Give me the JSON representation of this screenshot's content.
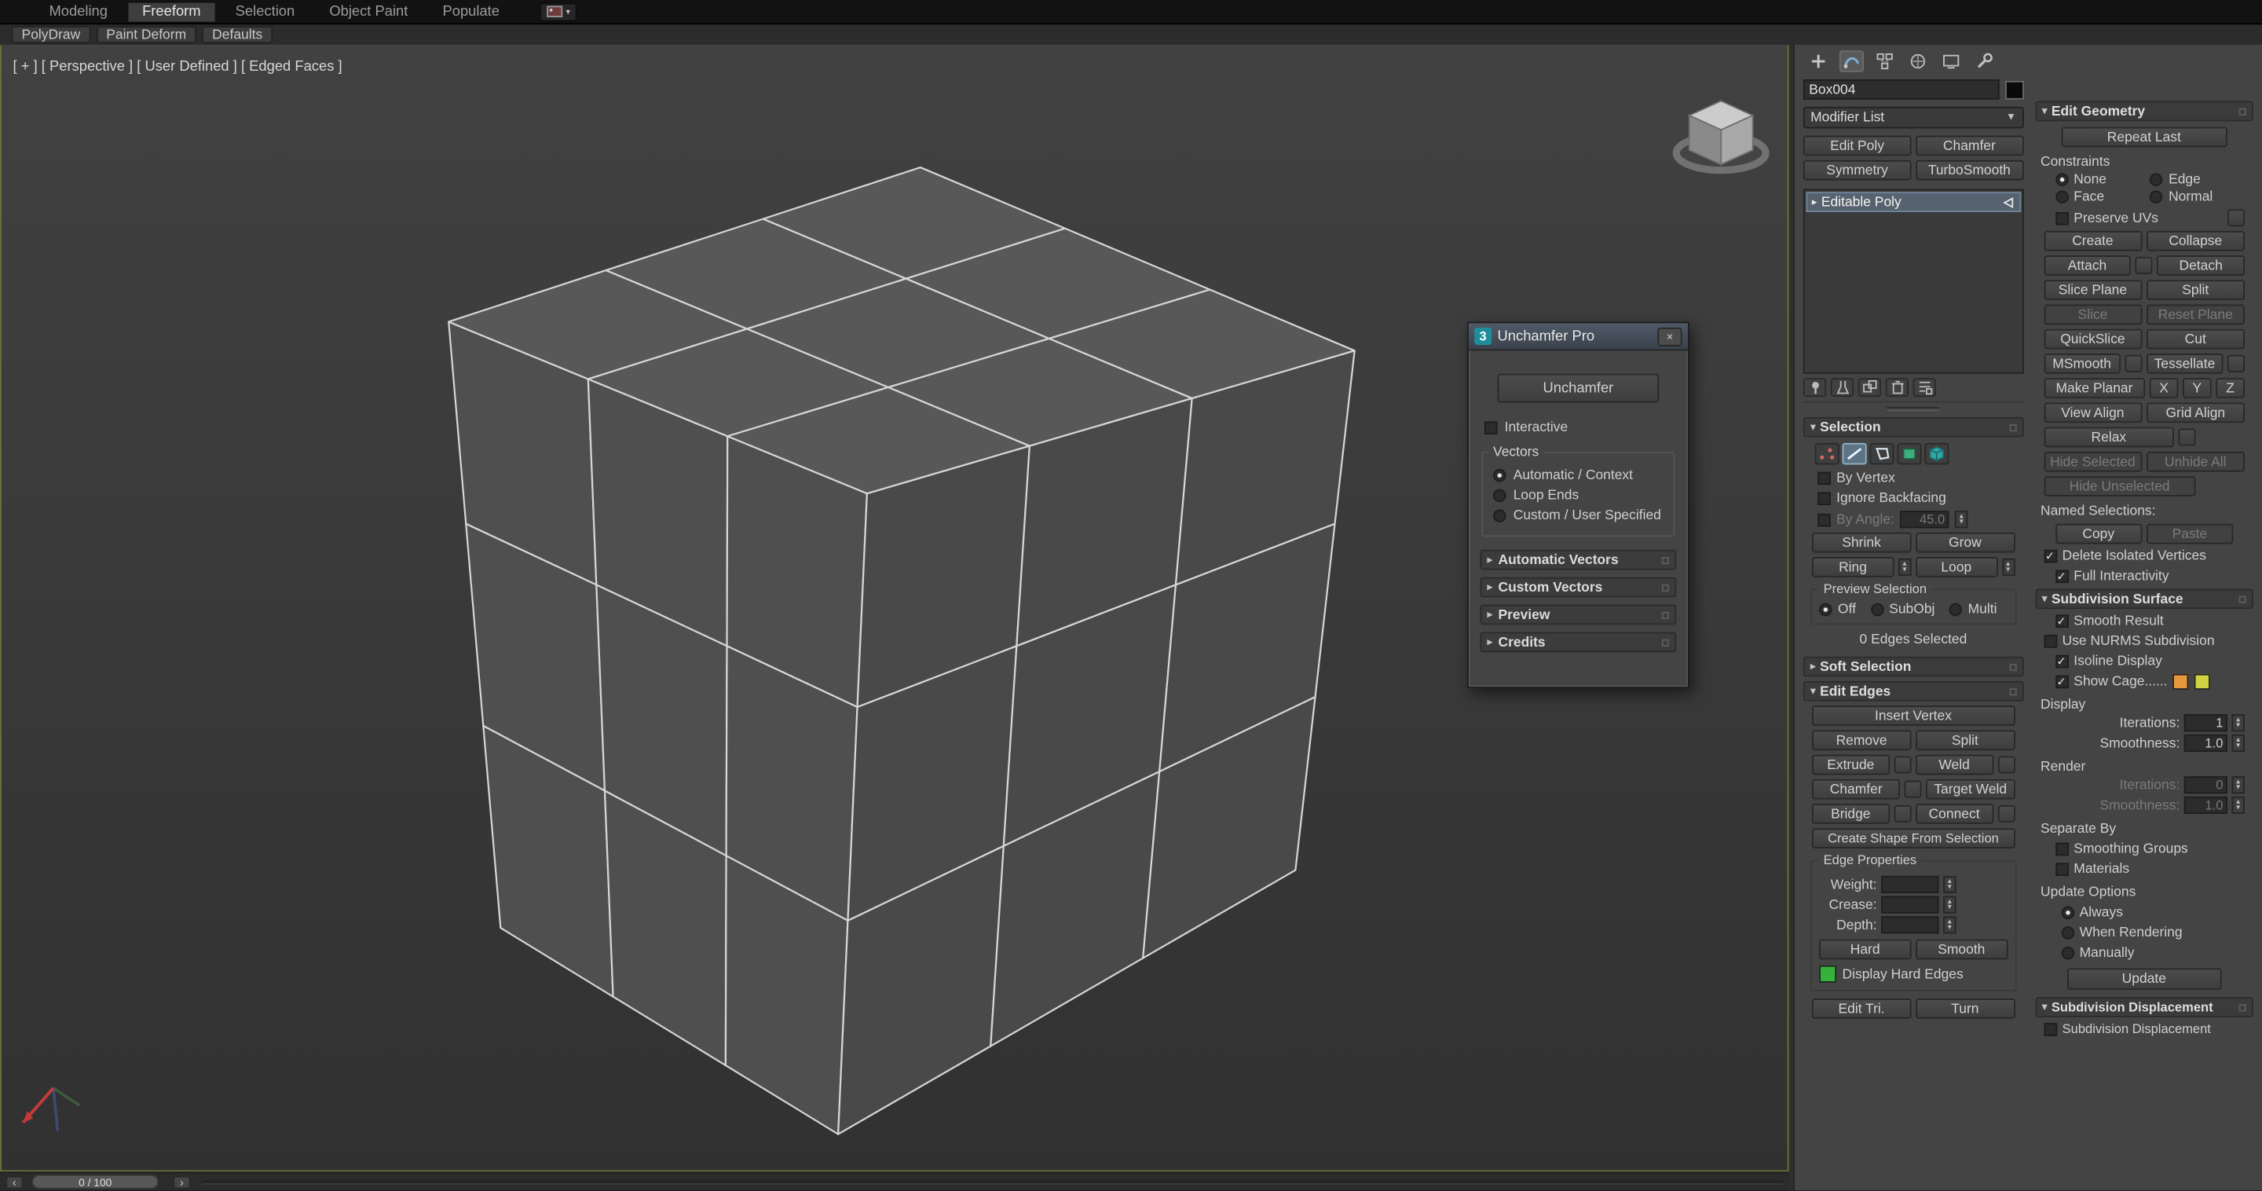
{
  "icons": {
    "close": "×",
    "dropdown": "▼",
    "up": "▴",
    "down": "▾",
    "expanded": "▾",
    "collapsed": "▸",
    "stack_arrow": "▸",
    "left": "‹",
    "right": "›",
    "logo": "3",
    "check": "✓"
  },
  "colors": {
    "viewport_border": "#70703e",
    "selection_highlight": "#566270",
    "object_color_swatch": "#0a0a0a",
    "hard_edges_swatch": "#35b23b",
    "cage_swatch_1": "#e8983c",
    "cage_swatch_2": "#cfd342"
  },
  "ribbon": {
    "tabs": [
      {
        "label": "Modeling"
      },
      {
        "label": "Freeform"
      },
      {
        "label": "Selection"
      },
      {
        "label": "Object Paint"
      },
      {
        "label": "Populate"
      }
    ],
    "active_tab": "Freeform",
    "subtabs": [
      {
        "label": "PolyDraw"
      },
      {
        "label": "Paint Deform"
      },
      {
        "label": "Defaults"
      }
    ]
  },
  "viewport": {
    "label": "[ + ] [ Perspective ] [ User Defined ] [ Edged Faces ]"
  },
  "dialog": {
    "title": "Unchamfer Pro",
    "buttons": {
      "unchamfer": "Unchamfer"
    },
    "interactive": "Interactive",
    "vectors": {
      "label": "Vectors",
      "automatic": "Automatic / Context",
      "loop_ends": "Loop Ends",
      "custom": "Custom / User Specified",
      "selected": "Automatic / Context"
    },
    "rollouts": {
      "automatic_vectors": "Automatic Vectors",
      "custom_vectors": "Custom Vectors",
      "preview": "Preview",
      "credits": "Credits"
    }
  },
  "panel": {
    "object_name": "Box004",
    "modifier_list": "Modifier List",
    "presets": {
      "edit_poly": "Edit Poly",
      "chamfer": "Chamfer",
      "symmetry": "Symmetry",
      "turbosmooth": "TurboSmooth"
    },
    "stack_item": "Editable Poly",
    "selection": {
      "title": "Selection",
      "by_vertex": "By Vertex",
      "ignore_backfacing": "Ignore Backfacing",
      "by_angle": "By Angle:",
      "by_angle_value": "45.0",
      "shrink": "Shrink",
      "grow": "Grow",
      "ring": "Ring",
      "loop": "Loop",
      "preview_label": "Preview Selection",
      "off": "Off",
      "subobj": "SubObj",
      "multi": "Multi",
      "status": "0 Edges Selected"
    },
    "soft_selection": {
      "title": "Soft Selection"
    },
    "edit_edges": {
      "title": "Edit Edges",
      "insert_vertex": "Insert Vertex",
      "remove": "Remove",
      "split": "Split",
      "extrude": "Extrude",
      "weld": "Weld",
      "chamfer": "Chamfer",
      "target_weld": "Target Weld",
      "bridge": "Bridge",
      "connect": "Connect",
      "create_shape": "Create Shape From Selection",
      "edge_properties": "Edge Properties",
      "weight": "Weight:",
      "crease": "Crease:",
      "depth": "Depth:",
      "hard": "Hard",
      "smooth": "Smooth",
      "display_hard_edges": "Display Hard Edges",
      "edit_tri": "Edit Tri.",
      "turn": "Turn"
    },
    "edit_geometry": {
      "title": "Edit Geometry",
      "repeat_last": "Repeat Last",
      "constraints": "Constraints",
      "none": "None",
      "edge": "Edge",
      "face": "Face",
      "normal": "Normal",
      "preserve_uvs": "Preserve UVs",
      "create": "Create",
      "collapse": "Collapse",
      "attach": "Attach",
      "detach": "Detach",
      "slice_plane": "Slice Plane",
      "split": "Split",
      "slice": "Slice",
      "reset_plane": "Reset Plane",
      "quickslice": "QuickSlice",
      "cut": "Cut",
      "msmooth": "MSmooth",
      "tessellate": "Tessellate",
      "make_planar": "Make Planar",
      "x": "X",
      "y": "Y",
      "z": "Z",
      "view_align": "View Align",
      "grid_align": "Grid Align",
      "relax": "Relax",
      "hide_selected": "Hide Selected",
      "unhide_all": "Unhide All",
      "hide_unselected": "Hide Unselected",
      "named_selections": "Named Selections:",
      "copy": "Copy",
      "paste": "Paste",
      "delete_isolated": "Delete Isolated Vertices",
      "full_interactivity": "Full Interactivity"
    },
    "subdivision_surface": {
      "title": "Subdivision Surface",
      "smooth_result": "Smooth Result",
      "use_nurms": "Use NURMS Subdivision",
      "isoline_display": "Isoline Display",
      "show_cage": "Show Cage......",
      "display": "Display",
      "iterations": "Iterations:",
      "smoothness": "Smoothness:",
      "display_iterations_value": "1",
      "display_smoothness_value": "1.0",
      "render": "Render",
      "render_iterations_value": "0",
      "render_smoothness_value": "1.0",
      "separate_by": "Separate By",
      "smoothing_groups": "Smoothing Groups",
      "materials": "Materials",
      "update_options": "Update Options",
      "always": "Always",
      "when_rendering": "When Rendering",
      "manually": "Manually",
      "update": "Update"
    },
    "subdivision_displacement": {
      "title": "Subdivision Displacement",
      "checkbox": "Subdivision Displacement"
    }
  },
  "timeline": {
    "value": "0 / 100"
  }
}
